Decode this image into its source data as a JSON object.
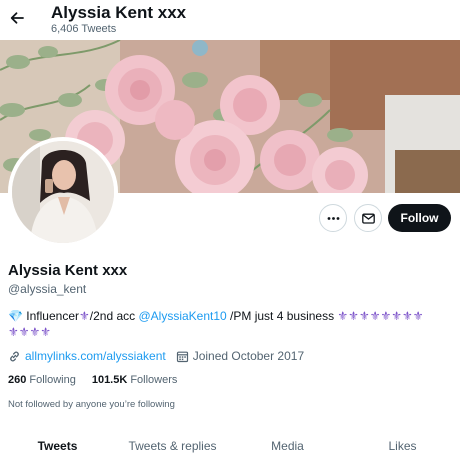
{
  "header": {
    "title": "Alyssia Kent xxx",
    "tweet_count": "6,406 Tweets",
    "back_icon": "arrow-left-icon"
  },
  "actions": {
    "more_icon": "more-dots-icon",
    "message_icon": "envelope-icon",
    "follow_label": "Follow"
  },
  "profile": {
    "display_name": "Alyssia Kent xxx",
    "handle": "@alyssia_kent",
    "bio": {
      "diamond": "💎",
      "part1": " Influencer",
      "fleur": "⚜",
      "part2": "/2nd acc ",
      "mention": "@AlyssiaKent10",
      "part3": " /PM just 4 business ",
      "fleurs_line": "⚜⚜⚜⚜⚜⚜⚜⚜",
      "fleurs_line2": "⚜⚜⚜⚜"
    },
    "link": "allmylinks.com/alyssiakent",
    "link_icon": "link-icon",
    "joined": "Joined October 2017",
    "calendar_icon": "calendar-icon",
    "following_count": "260",
    "following_label": "Following",
    "followers_count": "101.5K",
    "followers_label": "Followers",
    "not_followed_text": "Not followed by anyone you’re following"
  },
  "tabs": [
    {
      "label": "Tweets",
      "active": true
    },
    {
      "label": "Tweets & replies",
      "active": false
    },
    {
      "label": "Media",
      "active": false
    },
    {
      "label": "Likes",
      "active": false
    }
  ],
  "colors": {
    "accent": "#1d9bf0",
    "text_primary": "#0f1419",
    "text_secondary": "#536471",
    "follow_button": "#0f1419"
  }
}
